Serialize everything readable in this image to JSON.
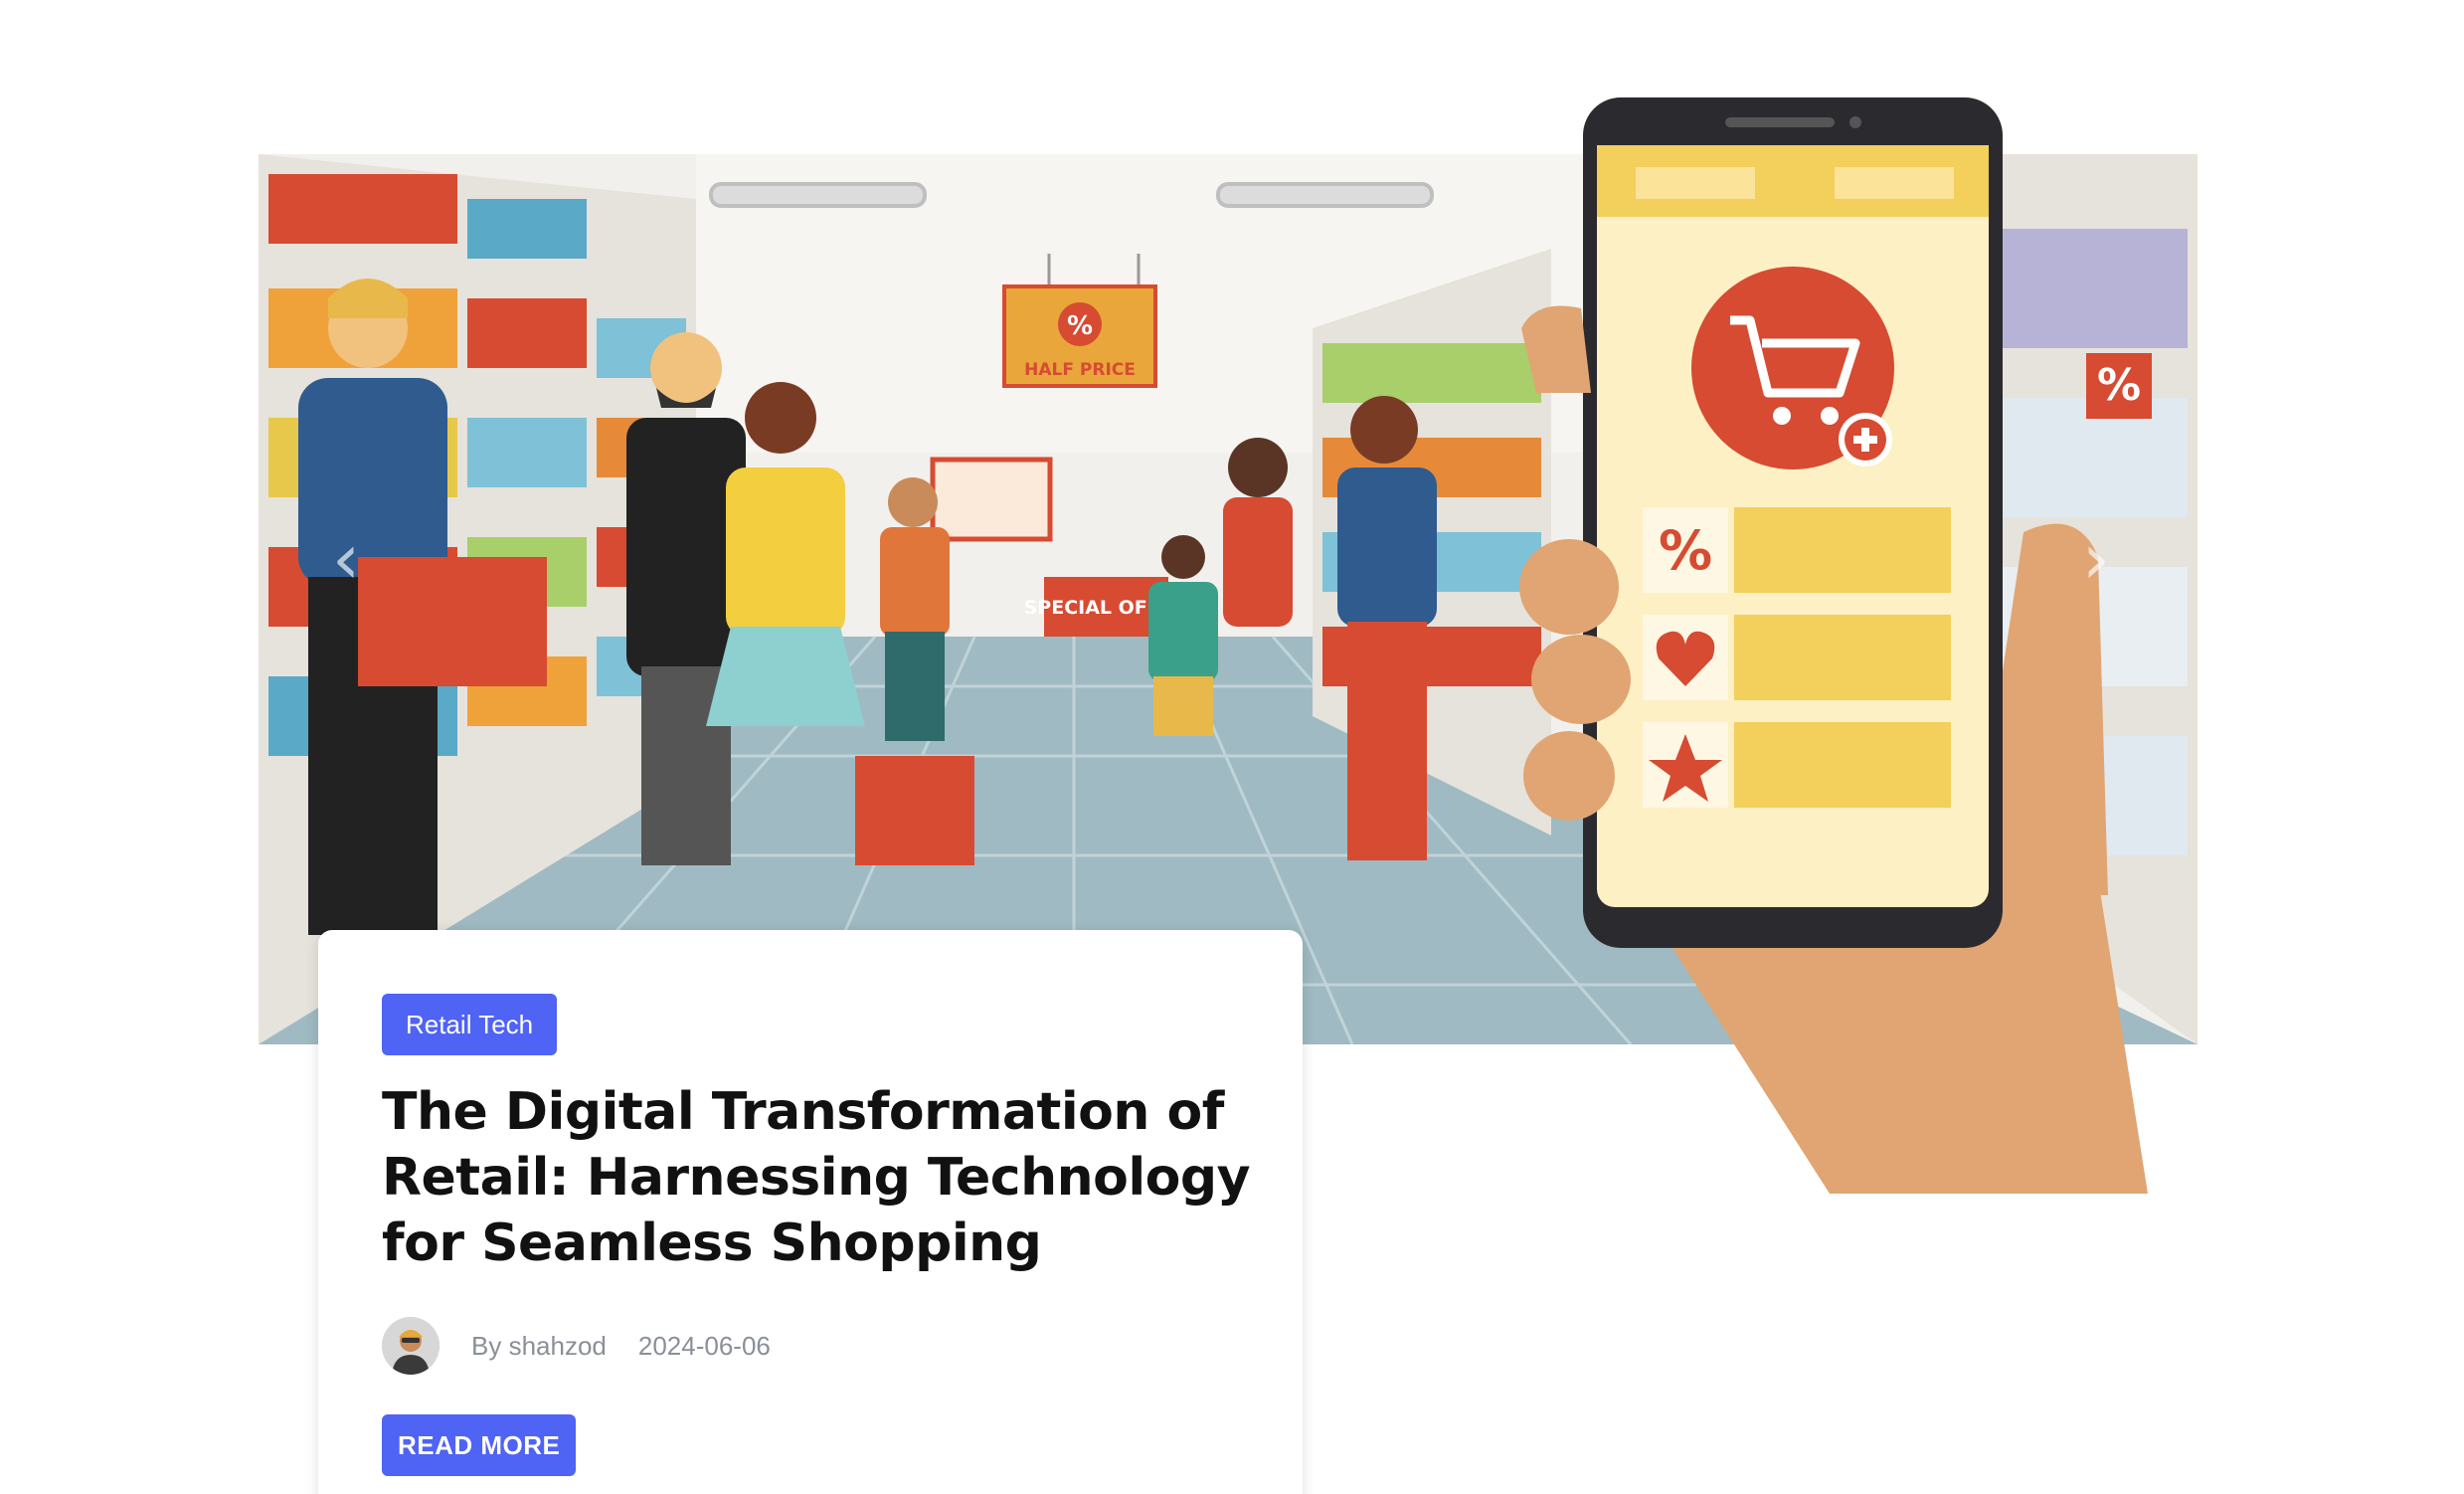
{
  "slider": {
    "prev_icon": "chevron-left-icon",
    "next_icon": "chevron-right-icon",
    "prev_glyph": "‹",
    "next_glyph": "›",
    "illustration": {
      "sign_text": "HALF PRICE",
      "offer_text": "SPECIAL OFFER",
      "percent_glyph": "%"
    }
  },
  "post": {
    "category": "Retail Tech",
    "title": "The Digital Transformation of Retail: Harnessing Technology for Seamless Shopping",
    "author": "By shahzod",
    "date": "2024-06-06",
    "read_more": "READ MORE"
  },
  "colors": {
    "accent": "#4f63f5",
    "title_text": "#111111",
    "meta_text": "#8a8f98"
  }
}
